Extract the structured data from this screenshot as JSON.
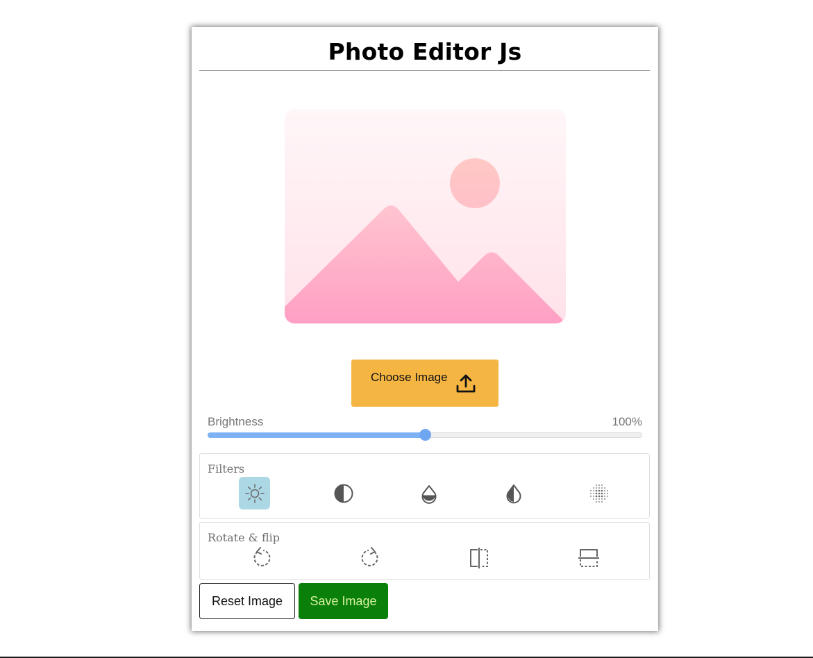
{
  "app": {
    "title": "Photo Editor Js"
  },
  "colors": {
    "accent_orange": "#f4b543",
    "active_filter_bg": "#acd8e6",
    "slider_fill": "#7eb2f5",
    "save_green": "#0a7f0a",
    "placeholder_pink": "#ff9fc4"
  },
  "preview": {
    "icon": "image-placeholder-icon"
  },
  "choose": {
    "label": "Choose Image",
    "icon": "upload-icon"
  },
  "slider": {
    "label": "Brightness",
    "value_text": "100%",
    "fraction": 0.5
  },
  "filters": {
    "label": "Filters",
    "items": [
      {
        "name": "brightness",
        "icon": "sun-icon",
        "active": true
      },
      {
        "name": "contrast",
        "icon": "half-circle-icon",
        "active": false
      },
      {
        "name": "saturation",
        "icon": "droplet-half-icon",
        "active": false
      },
      {
        "name": "inversion",
        "icon": "inverted-droplet-icon",
        "active": false
      },
      {
        "name": "grayscale",
        "icon": "dot-grid-icon",
        "active": false
      }
    ]
  },
  "rotate": {
    "label": "Rotate & flip",
    "items": [
      {
        "name": "rotate-left",
        "icon": "rotate-left-icon"
      },
      {
        "name": "rotate-right",
        "icon": "rotate-right-icon"
      },
      {
        "name": "flip-horizontal",
        "icon": "flip-horizontal-icon"
      },
      {
        "name": "flip-vertical",
        "icon": "flip-vertical-icon"
      }
    ]
  },
  "actions": {
    "reset_label": "Reset Image",
    "save_label": "Save Image"
  }
}
